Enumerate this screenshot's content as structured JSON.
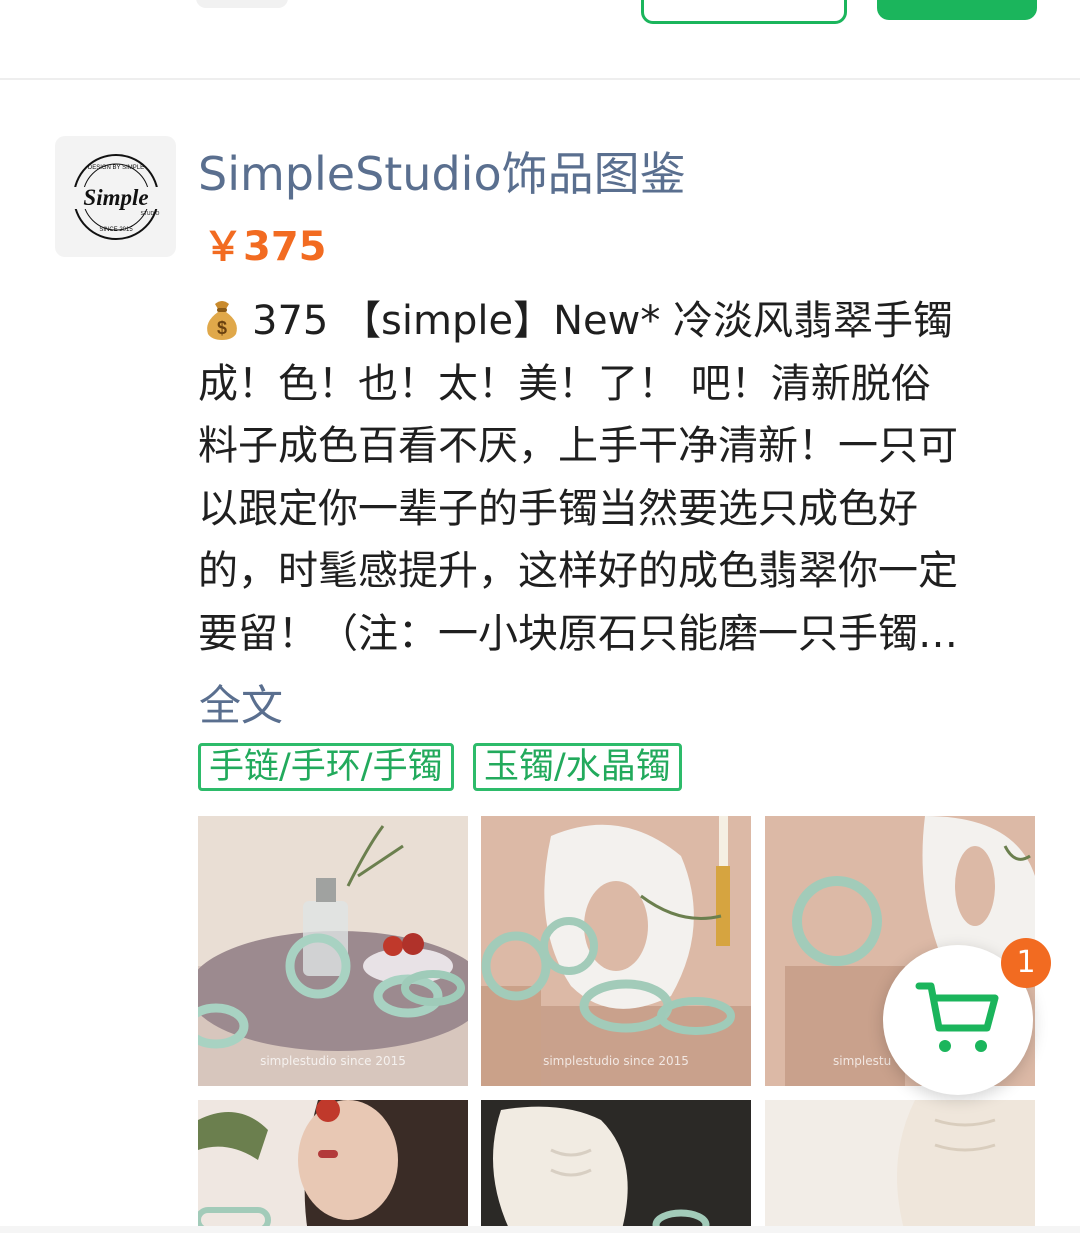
{
  "shop": {
    "name": "SimpleStudio饰品图鉴",
    "logo_text": "Simple",
    "logo_ring_top": "DESIGN BY SIMPLE",
    "logo_ring_bottom": "SINCE 2015",
    "logo_sub": "STUDIO"
  },
  "post": {
    "price": "￥375",
    "description_lines": [
      "375 【simple】New* 冷淡风翡翠手镯",
      "成！色！也！太！美！了！ 吧！清新脱俗",
      "料子成色百看不厌，上手干净清新！一只可",
      "以跟定你一辈子的手镯当然要选只成色好",
      "的，时髦感提升，这样好的成色翡翠你一定",
      "要留！（注：一小块原石只能磨一只手镯…"
    ],
    "full_text_link": "全文",
    "tags": [
      "手链/手环/手镯",
      "玉镯/水晶镯"
    ]
  },
  "images": {
    "watermark": "simplestudio since 2015",
    "watermark_short": "simplestu"
  },
  "cart": {
    "badge_count": "1",
    "accent_color": "#1bb55c"
  },
  "colors": {
    "brand_green": "#1bb55c",
    "price_orange": "#f26b21",
    "link_blue": "#5a6f8f"
  }
}
